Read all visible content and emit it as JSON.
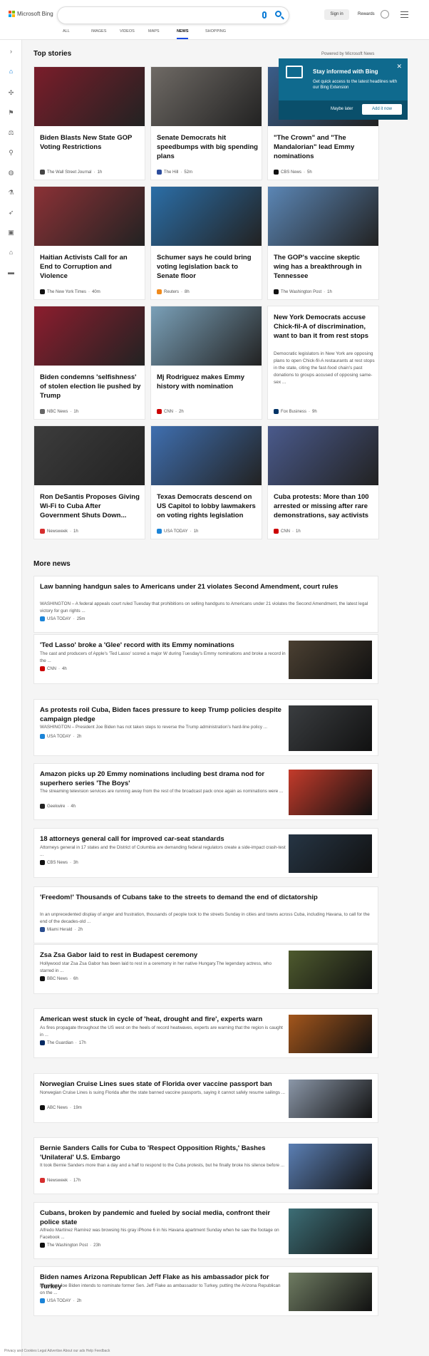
{
  "header": {
    "brand": "Microsoft Bing",
    "sign_in": "Sign in",
    "rewards": "Rewards",
    "tabs": [
      "ALL",
      "IMAGES",
      "VIDEOS",
      "MAPS",
      "NEWS",
      "SHOPPING"
    ]
  },
  "top": {
    "title": "Top stories",
    "powered": "Powered by Microsoft News",
    "cards": [
      {
        "title": "Biden Blasts New State GOP Voting Restrictions",
        "src": "The Wall Street Journal",
        "time": "1h",
        "color": "#7a1d2a",
        "icon": "#444"
      },
      {
        "title": "Senate Democrats hit speedbumps with big spending plans",
        "src": "The Hill",
        "time": "52m",
        "color": "#6f6a65",
        "icon": "#2c4c9c"
      },
      {
        "title": "\"The Crown\" and \"The Mandalorian\" lead Emmy nominations",
        "src": "CBS News",
        "time": "5h",
        "color": "#3a5d89",
        "icon": "#111"
      },
      {
        "title": "Haitian Activists Call for an End to Corruption and Violence",
        "src": "The New York Times",
        "time": "40m",
        "color": "#8b3136",
        "icon": "#111"
      },
      {
        "title": "Schumer says he could bring voting legislation back to Senate floor",
        "src": "Reuters",
        "time": "8h",
        "color": "#2b6ea7",
        "icon": "#f08a1c"
      },
      {
        "title": "The GOP's vaccine skeptic wing has a breakthrough in Tennessee",
        "src": "The Washington Post",
        "time": "1h",
        "color": "#5b86b5",
        "icon": "#111"
      },
      {
        "title": "Biden condemns 'selfishness' of stolen election lie pushed by Trump",
        "src": "NBC News",
        "time": "1h",
        "color": "#8c1d2e",
        "icon": "#666"
      },
      {
        "title": "Mj Rodriguez makes Emmy history with nomination",
        "src": "CNN",
        "time": "2h",
        "color": "#7aa0b8",
        "icon": "#cc0000"
      },
      {
        "title": "New York Democrats accuse Chick-fil-A of discrimination, want to ban it from rest stops",
        "desc": "Democratic legislators in New York are opposing plans to open Chick-fil-A restaurants at rest stops in the state, citing the fast-food chain's past donations to groups accused of opposing same-sex ...",
        "src": "Fox Business",
        "time": "9h",
        "icon": "#003366"
      },
      {
        "title": "Ron DeSantis Proposes Giving Wi-Fi to Cuba After Government Shuts Down...",
        "src": "Newsweek",
        "time": "1h",
        "color": "#3c3c3c",
        "icon": "#d62e2e"
      },
      {
        "title": "Texas Democrats descend on US Capitol to lobby lawmakers on voting rights legislation",
        "src": "USA TODAY",
        "time": "1h",
        "color": "#3f6fb0",
        "icon": "#1b84d8"
      },
      {
        "title": "Cuba protests: More than 100 arrested or missing after rare demonstrations, say activists",
        "src": "CNN",
        "time": "1h",
        "color": "#4a5a8c",
        "icon": "#cc0000"
      }
    ]
  },
  "more": {
    "title": "More news",
    "items": [
      {
        "title": "Law banning handgun sales to Americans under 21 violates Second Amendment, court rules",
        "desc": "WASHINGTON – A federal appeals court ruled Tuesday that prohibitions on selling handguns to Americans under 21 violates the Second Amendment, the latest legal victory for gun rights ...",
        "src": "USA TODAY",
        "time": "25m",
        "icon": "#1b84d8"
      },
      {
        "title": "'Ted Lasso' broke a 'Glee' record with its Emmy nominations",
        "desc": "The cast and producers of Apple's 'Ted Lasso' scored a major W during Tuesday's Emmy nominations and broke a record in the ...",
        "src": "CNN",
        "time": "4h",
        "icon": "#cc0000",
        "thumb": "#4b4032"
      },
      {
        "title": "As protests roil Cuba, Biden faces pressure to keep Trump policies despite campaign pledge",
        "desc": "WASHINGTON – President Joe Biden has not taken steps to reverse the Trump administration's hard-line policy ...",
        "src": "USA TODAY",
        "time": "2h",
        "icon": "#1b84d8",
        "thumb": "#3a3d40"
      },
      {
        "title": "Amazon picks up 20 Emmy nominations including best drama nod for superhero series 'The Boys'",
        "desc": "The streaming television services are running away from the rest of the broadcast pack once again as nominations were ...",
        "src": "Geekwire",
        "time": "4h",
        "icon": "#222",
        "thumb": "#c43b2b"
      },
      {
        "title": "18 attorneys general call for improved car-seat standards",
        "desc": "Attorneys general in 17 states and the District of Columbia are demanding federal regulators create a side-impact crash-test ...",
        "src": "CBS News",
        "time": "3h",
        "icon": "#111",
        "thumb": "#263544"
      },
      {
        "title": "'Freedom!' Thousands of Cubans take to the streets to demand the end of dictatorship",
        "desc": "In an unprecedented display of anger and frustration, thousands of people took to the streets Sunday in cities and towns across Cuba, including Havana, to call for the end of the decades-old ...",
        "src": "Miami Herald",
        "time": "2h",
        "icon": "#2a4d8f"
      },
      {
        "title": "Zsa Zsa Gabor laid to rest in Budapest ceremony",
        "desc": "Hollywood star Zsa Zsa Gabor has been laid to rest in a ceremony in her native Hungary.The legendary actress, who starred in ...",
        "src": "BBC News",
        "time": "6h",
        "icon": "#111",
        "thumb": "#4e5a2e"
      },
      {
        "title": "American west stuck in cycle of 'heat, drought and fire', experts warn",
        "desc": "As fires propagate throughout the US west on the heels of record heatwaves, experts are warning that the region is caught in ...",
        "src": "The Guardian",
        "time": "17h",
        "icon": "#052962",
        "thumb": "#a3561c"
      },
      {
        "title": "Norwegian Cruise Lines sues state of Florida over vaccine passport ban",
        "desc": "Norwegian Cruise Lines is suing Florida after the state banned vaccine passports, saying it cannot safely resume sailings ...",
        "src": "ABC News",
        "time": "19m",
        "icon": "#111",
        "thumb": "#8b97a8"
      },
      {
        "title": "Bernie Sanders Calls for Cuba to 'Respect Opposition Rights,' Bashes 'Unilateral' U.S. Embargo",
        "desc": "It took Bernie Sanders more than a day and a half to respond to the Cuba protests, but he finally broke his silence before ...",
        "src": "Newsweek",
        "time": "17h",
        "icon": "#d62e2e",
        "thumb": "#5b7fb4"
      },
      {
        "title": "Cubans, broken by pandemic and fueled by social media, confront their police state",
        "desc": "Alfredo Martínez Ramírez was browsing his gray iPhone 6 in his Havana apartment Sunday when he saw the footage on Facebook ...",
        "src": "The Washington Post",
        "time": "23h",
        "icon": "#111",
        "thumb": "#3d6e76"
      },
      {
        "title": "Biden names Arizona Republican Jeff Flake as his ambassador pick for Turkey",
        "desc": "President Joe Biden intends to nominate former Sen. Jeff Flake as ambassador to Turkey, putting the Arizona Republican on the ...",
        "src": "USA TODAY",
        "time": "2h",
        "icon": "#1b84d8",
        "thumb": "#6f7c62"
      }
    ]
  },
  "popup": {
    "title": "Stay informed with Bing",
    "desc": "Get quick access to the latest headlines with our Bing Extension",
    "later": "Maybe later",
    "ok": "Add it now"
  },
  "footer": "Privacy and Cookies  Legal  Advertise  About our ads  Help  Feedback"
}
